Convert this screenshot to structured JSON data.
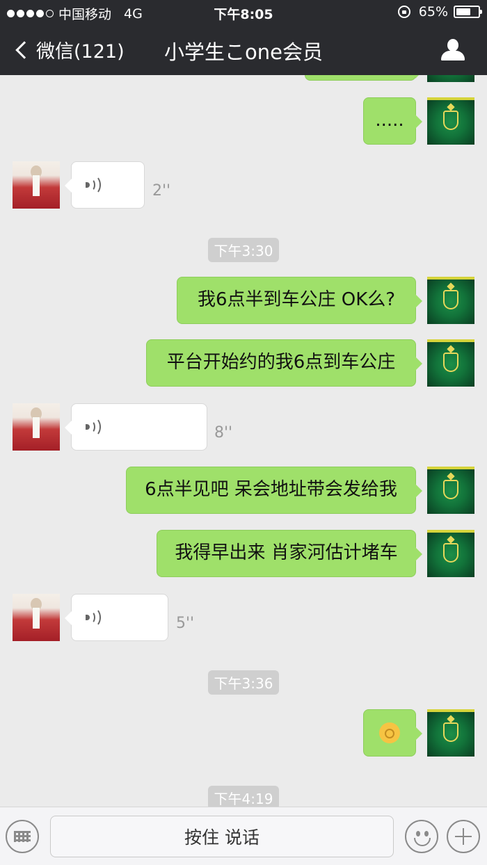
{
  "status_bar": {
    "carrier": "中国移动",
    "network": "4G",
    "time": "下午8:05",
    "battery_percent": "65%",
    "battery_level": 0.65
  },
  "nav": {
    "back_label": "微信(121)",
    "title": "小学生こone会员"
  },
  "messages": {
    "m1": {
      "text": "....."
    },
    "v1": {
      "duration": "2''"
    },
    "t1": {
      "text": "下午3:30"
    },
    "m2": {
      "text": "我6点半到车公庄 OK么?"
    },
    "m3": {
      "text": "平台开始约的我6点到车公庄"
    },
    "v2": {
      "duration": "8''"
    },
    "m4": {
      "text": "6点半见吧 呆会地址带会发给我"
    },
    "m5": {
      "text": "我得早出来 肖家河估计堵车"
    },
    "v3": {
      "duration": "5''"
    },
    "t2": {
      "text": "下午3:36"
    },
    "t3": {
      "text": "下午4:19"
    }
  },
  "bottom": {
    "talk_label": "按住 说话"
  },
  "icons": [
    "back-chevron-icon",
    "contact-icon",
    "voice-icon",
    "keyboard-icon",
    "emoji-icon",
    "plus-icon",
    "ok-hand-emoji"
  ]
}
